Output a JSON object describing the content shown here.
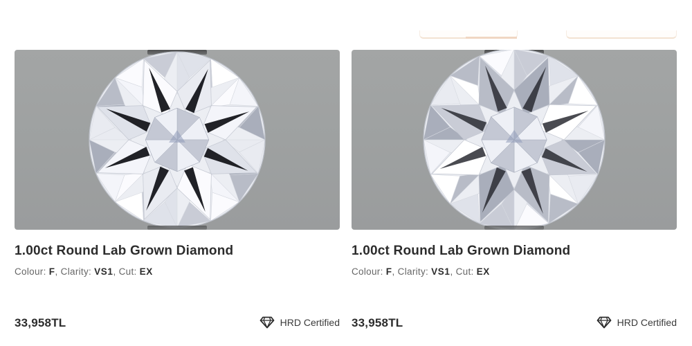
{
  "header": {
    "tabs": [
      {
        "label": ""
      },
      {
        "label": ""
      }
    ]
  },
  "products": [
    {
      "title": "1.00ct Round Lab Grown Diamond",
      "image_alt": "Round brilliant lab grown diamond",
      "specs": {
        "colour_label": "Colour:",
        "colour_value": "F",
        "clarity_label": "Clarity:",
        "clarity_value": "VS1",
        "cut_label": "Cut:",
        "cut_value": "EX",
        "separator": ","
      },
      "price": "33,958TL",
      "certification": "HRD Certified",
      "certification_icon": "diamond-outline-icon"
    },
    {
      "title": "1.00ct Round Lab Grown Diamond",
      "image_alt": "Round brilliant lab grown diamond",
      "specs": {
        "colour_label": "Colour:",
        "colour_value": "F",
        "clarity_label": "Clarity:",
        "clarity_value": "VS1",
        "cut_label": "Cut:",
        "cut_value": "EX",
        "separator": ","
      },
      "price": "33,958TL",
      "certification": "HRD Certified",
      "certification_icon": "diamond-outline-icon"
    }
  ],
  "colors": {
    "image_background": "#9ea1a1",
    "text_primary": "#2c2c2c",
    "text_secondary": "#666666",
    "tab_accent": "#f0d6c2"
  }
}
